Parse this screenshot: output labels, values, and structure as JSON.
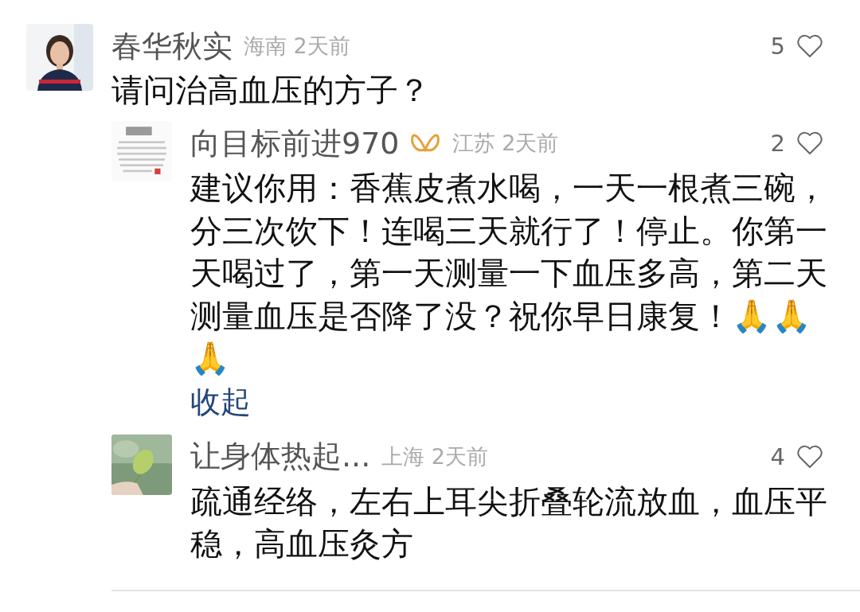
{
  "comments": [
    {
      "name": "春华秋实",
      "location": "海南",
      "time": "2天前",
      "likes": "5",
      "liked": false,
      "text": "请问治高血压的方子？",
      "replies": [
        {
          "name": "向目标前进970",
          "badge": true,
          "location": "江苏",
          "time": "2天前",
          "likes": "2",
          "liked": false,
          "text": "建议你用：香蕉皮煮水喝，一天一根煮三碗，分三次饮下！连喝三天就行了！停止。你第一天喝过了，第一天测量一下血压多高，第二天测量血压是否降了没？祝你早日康复！🙏🙏🙏",
          "collapse_link": "收起"
        },
        {
          "name": "让身体热起...",
          "badge": false,
          "location": "上海",
          "time": "2天前",
          "likes": "4",
          "liked": false,
          "text": "疏通经络，左右上耳尖折叠轮流放血，血压平稳，高血压灸方"
        }
      ]
    }
  ]
}
